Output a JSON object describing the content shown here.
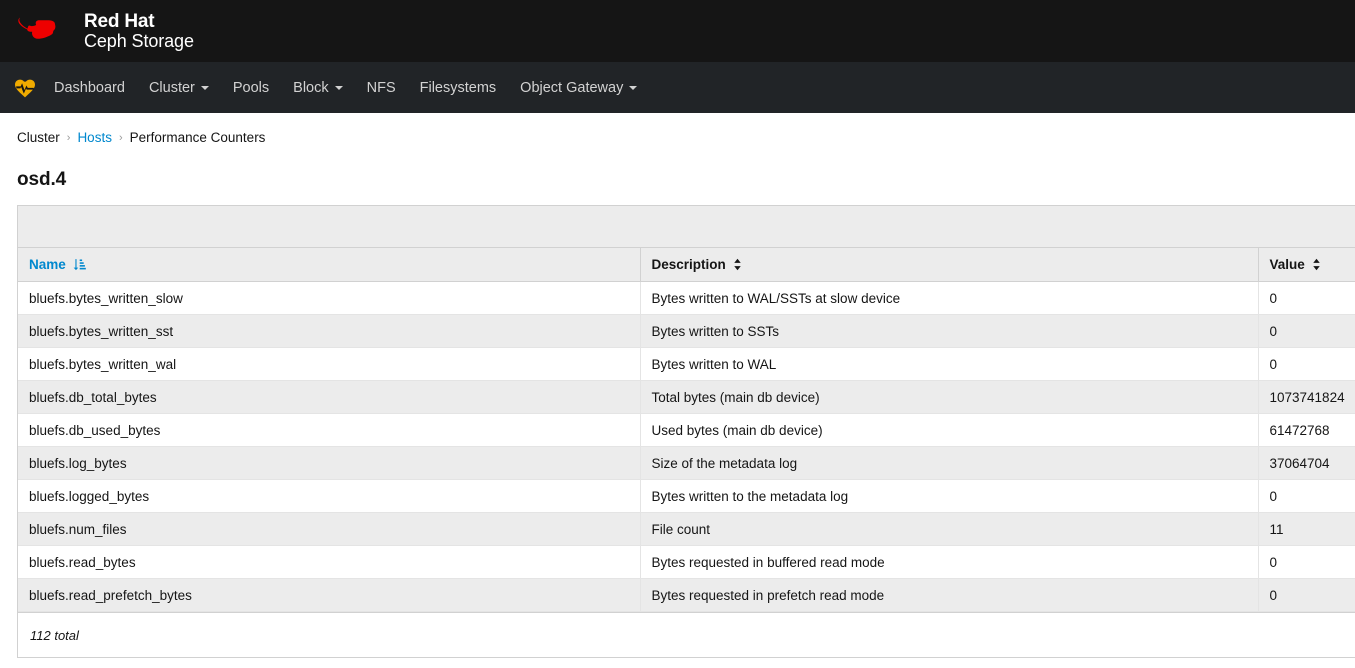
{
  "masthead": {
    "logo_icon": "redhat-fedora-logo",
    "brand_line1": "Red Hat",
    "brand_line2": "Ceph Storage",
    "logo_color": "#EE0000"
  },
  "navbar": {
    "health_icon": "heartbeat-icon",
    "health_icon_color": "#f0ab00",
    "items": [
      {
        "label": "Dashboard",
        "has_caret": false
      },
      {
        "label": "Cluster",
        "has_caret": true
      },
      {
        "label": "Pools",
        "has_caret": false
      },
      {
        "label": "Block",
        "has_caret": true
      },
      {
        "label": "NFS",
        "has_caret": false
      },
      {
        "label": "Filesystems",
        "has_caret": false
      },
      {
        "label": "Object Gateway",
        "has_caret": true
      }
    ]
  },
  "breadcrumb": {
    "items": [
      {
        "label": "Cluster",
        "is_link": false
      },
      {
        "label": "Hosts",
        "is_link": true
      },
      {
        "label": "Performance Counters",
        "is_link": false
      }
    ],
    "separator": "›"
  },
  "page": {
    "title": "osd.4"
  },
  "table": {
    "columns": [
      {
        "label": "Name",
        "sorted": true,
        "sort_icon": "sort-amount-asc-icon"
      },
      {
        "label": "Description",
        "sorted": false,
        "sort_icon": "sort-icon"
      },
      {
        "label": "Value",
        "sorted": false,
        "sort_icon": "sort-icon"
      }
    ],
    "rows": [
      {
        "name": "bluefs.bytes_written_slow",
        "description": "Bytes written to WAL/SSTs at slow device",
        "value": "0"
      },
      {
        "name": "bluefs.bytes_written_sst",
        "description": "Bytes written to SSTs",
        "value": "0"
      },
      {
        "name": "bluefs.bytes_written_wal",
        "description": "Bytes written to WAL",
        "value": "0"
      },
      {
        "name": "bluefs.db_total_bytes",
        "description": "Total bytes (main db device)",
        "value": "1073741824"
      },
      {
        "name": "bluefs.db_used_bytes",
        "description": "Used bytes (main db device)",
        "value": "61472768"
      },
      {
        "name": "bluefs.log_bytes",
        "description": "Size of the metadata log",
        "value": "37064704"
      },
      {
        "name": "bluefs.logged_bytes",
        "description": "Bytes written to the metadata log",
        "value": "0"
      },
      {
        "name": "bluefs.num_files",
        "description": "File count",
        "value": "11"
      },
      {
        "name": "bluefs.read_bytes",
        "description": "Bytes requested in buffered read mode",
        "value": "0"
      },
      {
        "name": "bluefs.read_prefetch_bytes",
        "description": "Bytes requested in prefetch read mode",
        "value": "0"
      }
    ],
    "footer_text": "112 total"
  },
  "colors": {
    "masthead_bg": "#151515",
    "navbar_bg": "#212427",
    "link_blue": "#0088ce",
    "row_alt_bg": "#ececec",
    "border": "#d1d1d1"
  }
}
